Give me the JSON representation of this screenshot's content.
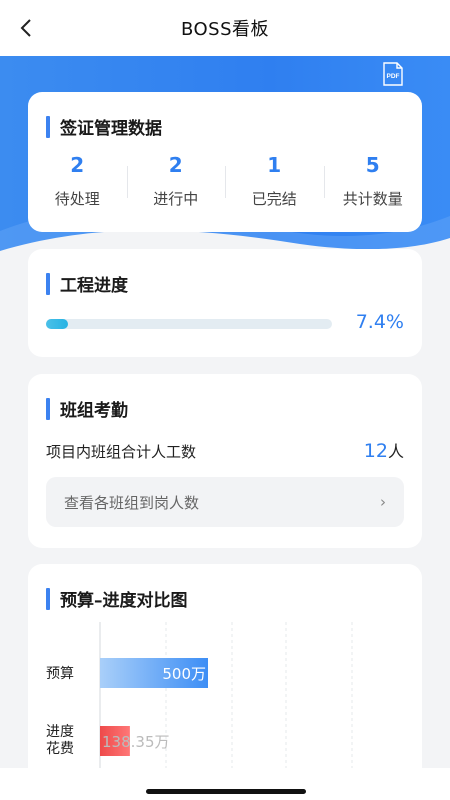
{
  "nav": {
    "title": "BOSS看板",
    "back_icon": "chevron-left-icon"
  },
  "toolbar": {
    "pdf_label": "PDF"
  },
  "visa": {
    "title": "签证管理数据",
    "stats": [
      {
        "value": "2",
        "label": "待处理"
      },
      {
        "value": "2",
        "label": "进行中"
      },
      {
        "value": "1",
        "label": "已完结"
      },
      {
        "value": "5",
        "label": "共计数量"
      }
    ]
  },
  "progress": {
    "title": "工程进度",
    "value_text": "7.4%",
    "fraction": 0.074
  },
  "attendance": {
    "title": "班组考勤",
    "label": "项目内班组合计人工数",
    "count": "12",
    "unit": "人",
    "link_text": "查看各班组到岗人数"
  },
  "budget": {
    "title": "预算–进度对比图"
  },
  "chart_data": {
    "type": "bar",
    "orientation": "horizontal",
    "categories": [
      "预算",
      "进度\n花费"
    ],
    "values": [
      500,
      138.35
    ],
    "data_labels": [
      "500万",
      "138.35万"
    ],
    "xlim": [
      0,
      1200
    ],
    "colors": [
      "#3d8ef5",
      "#ee4a4a"
    ]
  },
  "colors": {
    "accent": "#2f7ff0",
    "hero": "#3a8af2"
  }
}
